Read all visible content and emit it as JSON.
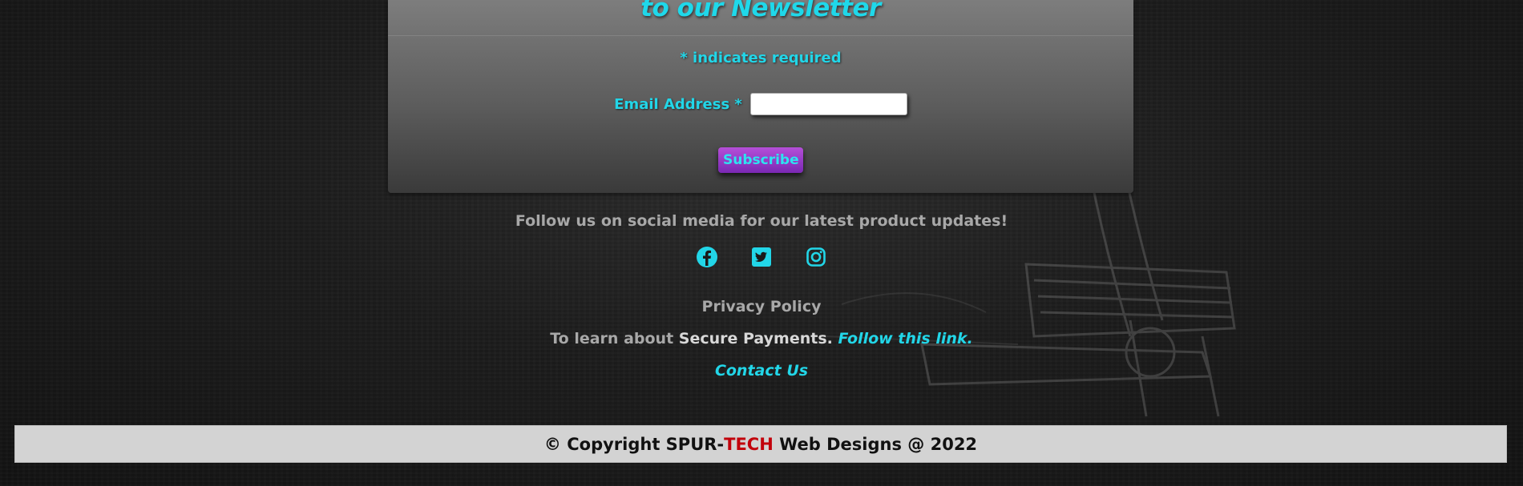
{
  "newsletter": {
    "title": "to our Newsletter",
    "required_note": "* indicates required",
    "email_label": "Email Address *",
    "email_value": "",
    "subscribe_label": "Subscribe"
  },
  "social": {
    "follow_text": "Follow us on social media for our latest product updates!",
    "icons": [
      "facebook-icon",
      "twitter-icon",
      "instagram-icon"
    ],
    "accent_color": "#22d6e8"
  },
  "links": {
    "privacy": "Privacy Policy",
    "secure_prefix": "To learn about ",
    "secure_strong": "Secure Payments.",
    "secure_link": "Follow this link.",
    "contact": "Contact Us"
  },
  "footer": {
    "copyright_prefix": "© Copyright SPUR-",
    "brand_highlight": "TECH",
    "copyright_suffix": " Web Designs @ 2022",
    "highlight_color": "#c2000b"
  }
}
